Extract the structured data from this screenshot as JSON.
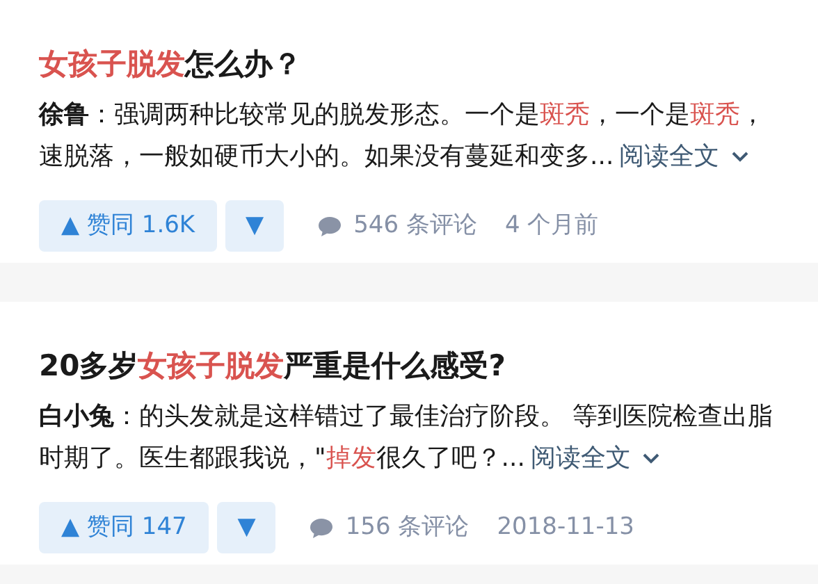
{
  "results": [
    {
      "title": [
        {
          "text": "女孩子脱发",
          "highlight": true
        },
        {
          "text": "怎么办？",
          "highlight": false
        }
      ],
      "author": "徐鲁",
      "lines": [
        [
          {
            "text": "：强调两种比较常见的脱发形态。一个是",
            "highlight": false
          },
          {
            "text": "斑秃",
            "highlight": true
          },
          {
            "text": "，一个是",
            "highlight": false
          },
          {
            "text": "斑秃",
            "highlight": true
          },
          {
            "text": "，",
            "highlight": false
          }
        ],
        [
          {
            "text": "速脱落，一般如硬币大小的。如果没有蔓延和变多...",
            "highlight": false
          }
        ]
      ],
      "read_more": "阅读全文",
      "upvote": "▲ 赞同 1.6K",
      "downvote": "▼",
      "comments": "546 条评论",
      "time": "4 个月前"
    },
    {
      "title": [
        {
          "text": "20多岁",
          "highlight": false
        },
        {
          "text": "女孩子脱发",
          "highlight": true
        },
        {
          "text": "严重是什么感受?",
          "highlight": false
        }
      ],
      "author": "白小兔",
      "lines": [
        [
          {
            "text": "：的头发就是这样错过了最佳治疗阶段。 等到医院检查出脂",
            "highlight": false
          }
        ],
        [
          {
            "text": "时期了。医生都跟我说，\"",
            "highlight": false
          },
          {
            "text": "掉发",
            "highlight": true
          },
          {
            "text": "很久了吧？...",
            "highlight": false
          }
        ]
      ],
      "read_more": "阅读全文",
      "upvote": "▲ 赞同 147",
      "downvote": "▼",
      "comments": "156 条评论",
      "time": "2018-11-13"
    }
  ]
}
